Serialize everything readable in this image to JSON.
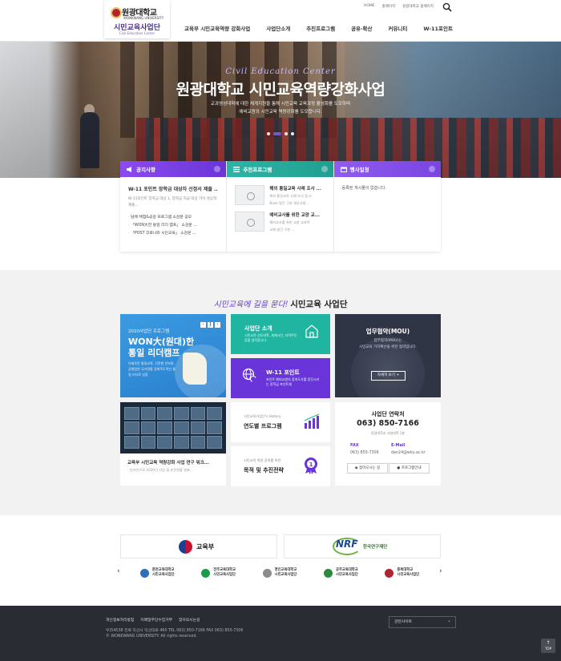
{
  "header": {
    "logo": {
      "university": "원광대학교",
      "university_en": "WONKWANG UNIVERSITY",
      "center_name": "시민교육사업단",
      "center_en": "Civil Education Center"
    },
    "util_links": [
      "HOME",
      "홈페이지",
      "원광대학교 홈페이지"
    ],
    "nav": [
      "교육부 시민교육역량 강화사업",
      "사업단소개",
      "추진프로그램",
      "공유·확산",
      "커뮤니티",
      "W-11포인트"
    ]
  },
  "hero": {
    "script": "Civil Education Center",
    "title": "원광대학교 시민교육역량강화사업",
    "desc_line1": "교과영성대학에 대한 체계지원을 통해 시민교육 교육과정 활성화를 도모하며",
    "desc_line2": "예비교원의 시민교육 역량강화를 도모합니다."
  },
  "notice": {
    "label": "공지사항",
    "title": "W-11 포인트 장학금 대상자 선정서 제출 ...",
    "desc": "W-11포인트 장학금 대상 1, 장학금 지급 대상 가이 성공적 제출...",
    "items": [
      "담배 체험&공감 프로그램 소감문 공모",
      "「WON大한 통일 리더 캠프」 소감문 ...",
      "「POST 코로나와 시민교육」 소감문 ..."
    ]
  },
  "recommend": {
    "label": "추천프로그램",
    "items": [
      {
        "title": "해외 통일교육 사례 조사 ...",
        "desc1": "해외 통일교육 사례 조사 및 e-",
        "desc2": "Book 발간 구분 세부사항..."
      },
      {
        "title": "예비교사를 위한 교양 교...",
        "desc1": "예비교사를 위한 교양 교과목",
        "desc2": "교재 발간 구분 ..."
      }
    ]
  },
  "event": {
    "label": "행사일정",
    "empty": "등록된 게시물이 없습니다."
  },
  "mid": {
    "script": "시민교육에 길을 묻다!",
    "bold": "시민교육 사업단"
  },
  "camp": {
    "year": "2020사업단 프로그램",
    "title1": "WON大(원대)한",
    "title2": "통일 리더캠프",
    "desc": "다채로운 통일교육, 건전한 안보관, 균형잡힌 국가관을 갖춰주도적인 통일 리더로 성장",
    "prev": "‹",
    "pause": "‖",
    "next": "›"
  },
  "intro": {
    "title": "사업단 소개",
    "desc": "시민교육 선도대학, 세계시민, 지역주민 등을 생각합니다."
  },
  "w11": {
    "title": "W-11 포인트",
    "desc": "포인트 예비교원의 참여도가를 증진시키는 장학금 포인트제"
  },
  "mou": {
    "title": "업무협약(MOU)",
    "desc1": "업무협약(MOU)는",
    "desc2": "시민교육 가치확산을 위한 협약입니다.",
    "button": "자세히 보기 +"
  },
  "video": {
    "title": "교육부 시민교육 역량강화 사업 연구 워크...",
    "desc": "- 온라인으로 2020년 사업 및 추진현황 발표..."
  },
  "history": {
    "label": "시민교육사업단's History",
    "title": "연도별 프로그램"
  },
  "goal": {
    "label": "시민교육 역량 강화를 위한",
    "title": "목적 및 추진전략"
  },
  "contact": {
    "title": "사업단 연락처",
    "phone": "063) 850-7166",
    "location": "원광대학교 사범대학 1층",
    "fax_label": "FAX",
    "fax": "063) 850-7306",
    "email_label": "E-Mail",
    "email": "dan24@wku.ac.kr",
    "btn_map": "찾아오시는 길",
    "btn_staff": "프로그램안내"
  },
  "partners": {
    "moe": "교육부",
    "nrf": "한국연구재단",
    "row": [
      {
        "l1": "춘천교육대학교",
        "l2": "시민교육사업단",
        "color": "#2e6fb5"
      },
      {
        "l1": "전주교육대학교",
        "l2": "시민교육사업단",
        "color": "#1c9a4b"
      },
      {
        "l1": "경인교육대학교",
        "l2": "시민교육사업단",
        "color": "#8c8c8c"
      },
      {
        "l1": "공주교육대학교",
        "l2": "시민교육사업단",
        "color": "#2b8a3e"
      },
      {
        "l1": "충북대학교",
        "l2": "시민교육사업단",
        "color": "#b3232f"
      }
    ],
    "prev": "‹",
    "next": "›"
  },
  "footer": {
    "links": [
      "개인정보처리방침",
      "이메일무단수집거부",
      "찾아오시는길"
    ],
    "address": "우)54538 전북 익산시 익산대로 460    TEL 063) 850-7166    FAX 063) 850-7306",
    "copyright": "© WONKWANG UNIVERSITY. All rights reserved.",
    "family_site": "관련사이트",
    "top": "TOP"
  },
  "colors": {
    "purple": "#6a35d8",
    "teal": "#1fb5a1",
    "navy": "#2f3545",
    "footer_bg": "#2a2c33"
  }
}
